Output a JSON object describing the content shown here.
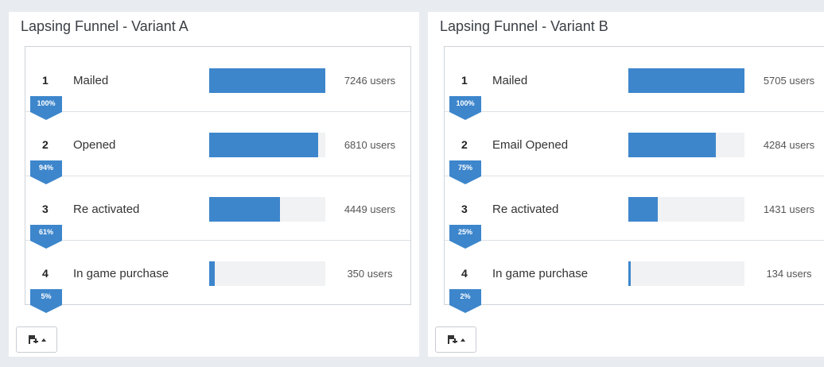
{
  "panels": [
    {
      "title": "Lapsing Funnel - Variant A",
      "steps": [
        {
          "num": "1",
          "label": "Mailed",
          "users": "7246 users",
          "pct": "100%",
          "fill": 1.0
        },
        {
          "num": "2",
          "label": "Opened",
          "users": "6810 users",
          "pct": "94%",
          "fill": 0.94
        },
        {
          "num": "3",
          "label": "Re activated",
          "users": "4449 users",
          "pct": "61%",
          "fill": 0.61
        },
        {
          "num": "4",
          "label": "In game purchase",
          "users": "350 users",
          "pct": "5%",
          "fill": 0.05
        }
      ]
    },
    {
      "title": "Lapsing Funnel - Variant B",
      "steps": [
        {
          "num": "1",
          "label": "Mailed",
          "users": "5705 users",
          "pct": "100%",
          "fill": 1.0
        },
        {
          "num": "2",
          "label": "Email Opened",
          "users": "4284 users",
          "pct": "75%",
          "fill": 0.75
        },
        {
          "num": "3",
          "label": "Re activated",
          "users": "1431 users",
          "pct": "25%",
          "fill": 0.25
        },
        {
          "num": "4",
          "label": "In game purchase",
          "users": "134 users",
          "pct": "2%",
          "fill": 0.02
        }
      ]
    }
  ],
  "icons": {
    "export": "export-flag-icon",
    "caret": "caret-up-icon"
  },
  "colors": {
    "bar": "#3d86cc",
    "track": "#f1f2f3",
    "badge": "#3d86cc"
  }
}
